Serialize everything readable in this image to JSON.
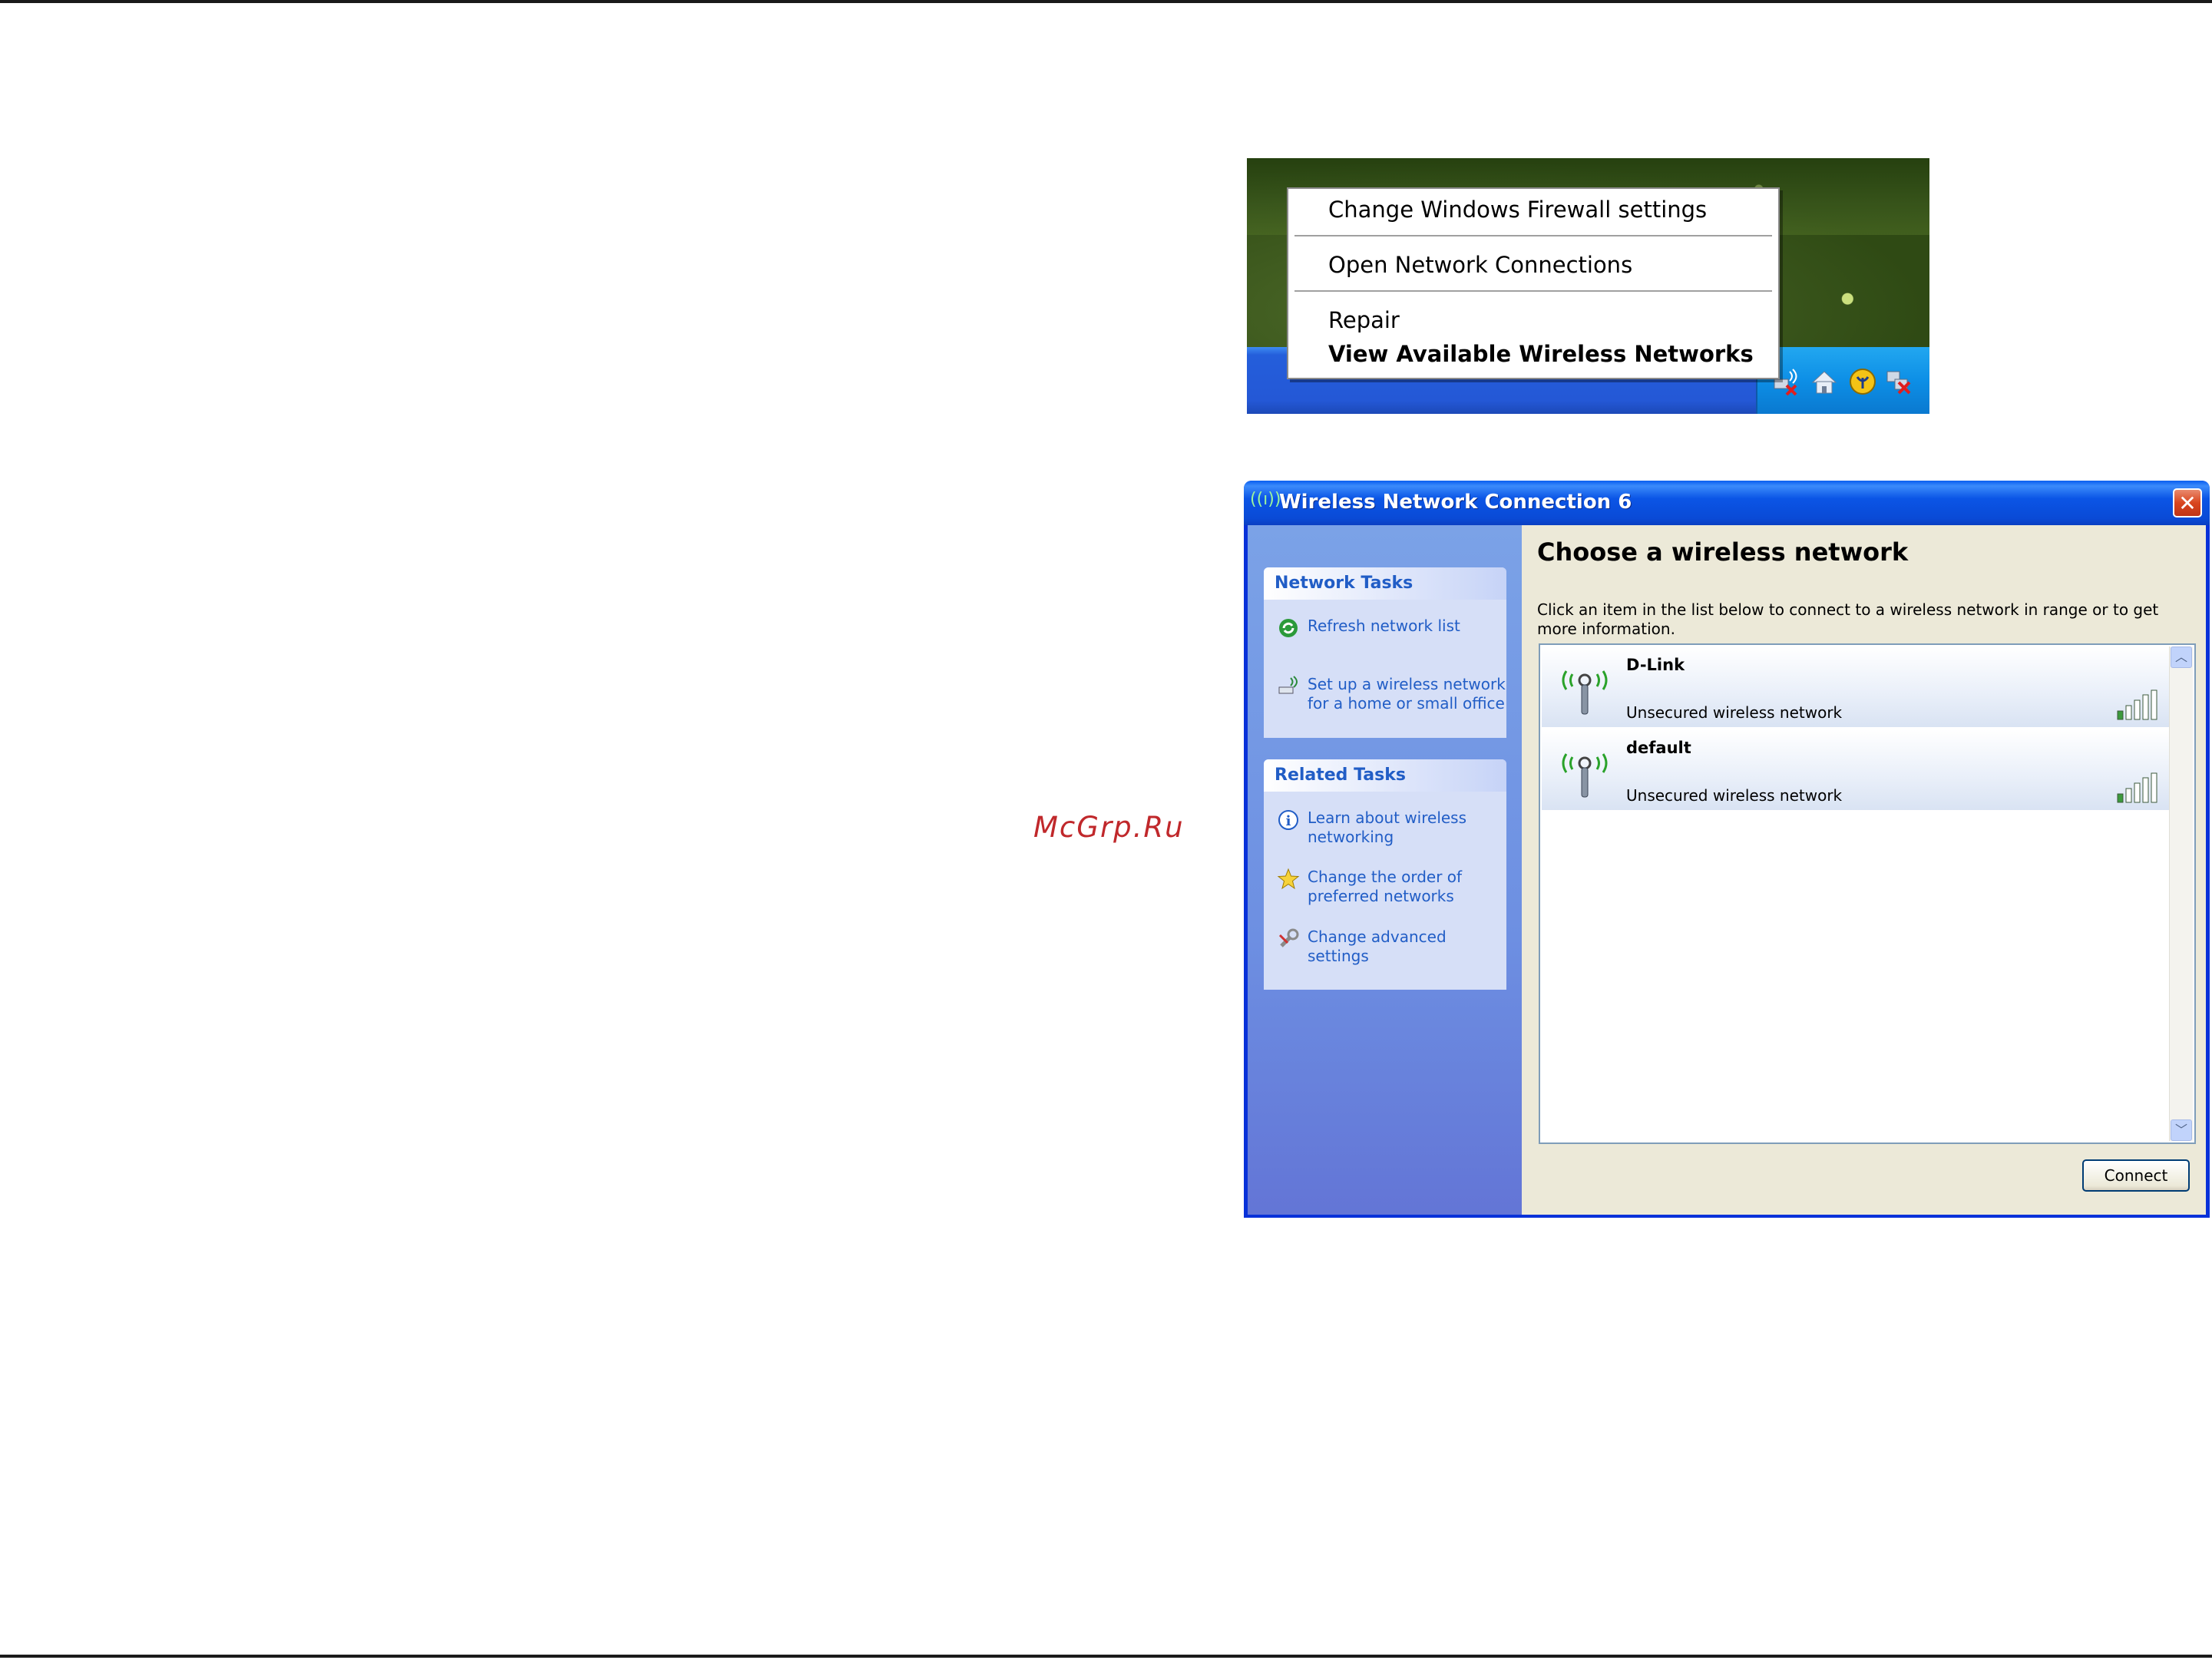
{
  "watermark": "McGrp.Ru",
  "context_menu": {
    "items": [
      "Change Windows Firewall settings",
      "Open Network Connections",
      "Repair",
      "View Available Wireless Networks"
    ]
  },
  "tray_icons": [
    "network-disconnected-icon",
    "home-icon",
    "security-center-icon",
    "network-error-icon"
  ],
  "dialog": {
    "title": "Wireless Network Connection 6",
    "network_tasks": {
      "header": "Network Tasks",
      "items": [
        {
          "label": "Refresh network list",
          "icon": "refresh-icon"
        },
        {
          "label": "Set up a wireless network for a home or small office",
          "icon": "setup-wireless-icon"
        }
      ]
    },
    "related_tasks": {
      "header": "Related Tasks",
      "items": [
        {
          "label": "Learn about wireless networking",
          "icon": "info-icon"
        },
        {
          "label": "Change the order of preferred networks",
          "icon": "star-icon"
        },
        {
          "label": "Change advanced settings",
          "icon": "settings-icon"
        }
      ]
    },
    "heading": "Choose a wireless network",
    "description": "Click an item in the list below to connect to a wireless network in range or to get more information.",
    "networks": [
      {
        "name": "D-Link",
        "security": "Unsecured wireless network",
        "signal": 1
      },
      {
        "name": "default",
        "security": "Unsecured wireless network",
        "signal": 1
      }
    ],
    "connect_label": "Connect"
  },
  "colors": {
    "title_bar": "#0a4ad6",
    "task_link": "#215dc6",
    "sidebar": "#6d8fe2",
    "content_bg": "#ece9d8"
  }
}
